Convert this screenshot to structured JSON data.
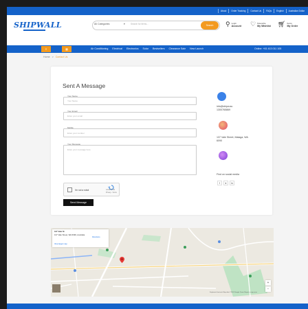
{
  "topbar": {
    "links": [
      "About",
      "Order Tracking",
      "Contact Us",
      "FAQs",
      "English",
      "Australian Dollar"
    ]
  },
  "header": {
    "logo": "SHIPWALL",
    "category": "All Categories",
    "search_placeholder": "Search for items...",
    "search_button": "Search",
    "login_top": "Login",
    "login_bottom": "Account",
    "wishlist_top": "Favourite",
    "wishlist_bottom": "My Wishlist",
    "cart_top": "Items",
    "cart_bottom": "My Order",
    "wishlist_count": "0",
    "cart_count": "0"
  },
  "nav": {
    "links": [
      "Air Conditioning",
      "Electrical",
      "Electronics",
      "Solar",
      "Bestsellers",
      "Clearance Sale",
      "New Launch"
    ],
    "online": "Online: +61 413 011 105"
  },
  "breadcrumb": {
    "home": "Home",
    "sep": ">",
    "current": "Contact Us"
  },
  "form": {
    "title": "Sent A Message",
    "name_label": "Your Name",
    "name_placeholder": "Your Name",
    "email_label": "Your Email",
    "email_placeholder": "Enter your email",
    "phone_label": "Mobile",
    "phone_placeholder": "Enter your number",
    "message_label": "Your Message",
    "message_placeholder": "Enter your message here",
    "captcha_label": "I'm not a robot",
    "captcha_brand": "reCAPTCHA",
    "captcha_terms": "Privacy - Terms",
    "submit": "Send Message"
  },
  "contact": {
    "email": "info@shipw.au",
    "phone": "1300765869",
    "address_line1": "137 Vale Street, Malaga, WA",
    "address_line2": "6090",
    "social_title": "Find on social media",
    "social": [
      "f",
      "♥",
      "in"
    ]
  },
  "map": {
    "place": "137 Vale St",
    "address": "137 Vale Street, WA 6090, Australia",
    "directions": "Directions",
    "link": "View larger map",
    "footer": "Keyboard shortcuts  Map data ©2024 Google  Terms  Report a map error"
  },
  "colors": {
    "brand": "#1462c9",
    "accent": "#f39a1f"
  }
}
